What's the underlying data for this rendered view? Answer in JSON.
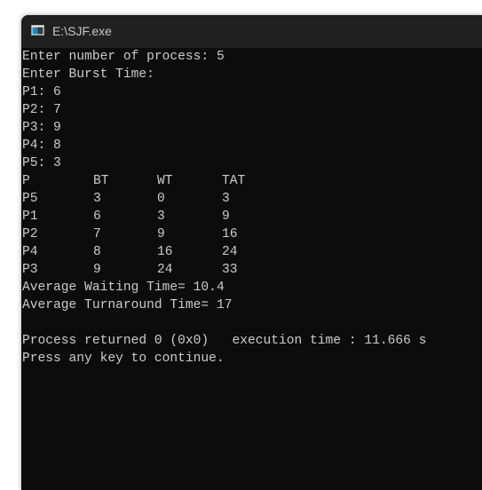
{
  "window": {
    "title": "E:\\SJF.exe"
  },
  "console": {
    "prompts": [
      "Enter number of process: 5",
      "Enter Burst Time:",
      "P1: 6",
      "P2: 7",
      "P3: 9",
      "P4: 8",
      "P5: 3"
    ],
    "table": {
      "headers": [
        "P",
        "BT",
        "WT",
        "TAT"
      ],
      "rows": [
        [
          "P5",
          "3",
          "0",
          "3"
        ],
        [
          "P1",
          "6",
          "3",
          "9"
        ],
        [
          "P2",
          "7",
          "9",
          "16"
        ],
        [
          "P4",
          "8",
          "16",
          "24"
        ],
        [
          "P3",
          "9",
          "24",
          "33"
        ]
      ]
    },
    "summary": [
      "Average Waiting Time= 10.4",
      "Average Turnaround Time= 17"
    ],
    "footer": [
      "Process returned 0 (0x0)   execution time : 11.666 s",
      "Press any key to continue."
    ]
  },
  "colors": {
    "console_background": "#0c0c0c",
    "console_text": "#cccccc",
    "titlebar_background": "#202020",
    "title_text": "#c8c8c8"
  }
}
